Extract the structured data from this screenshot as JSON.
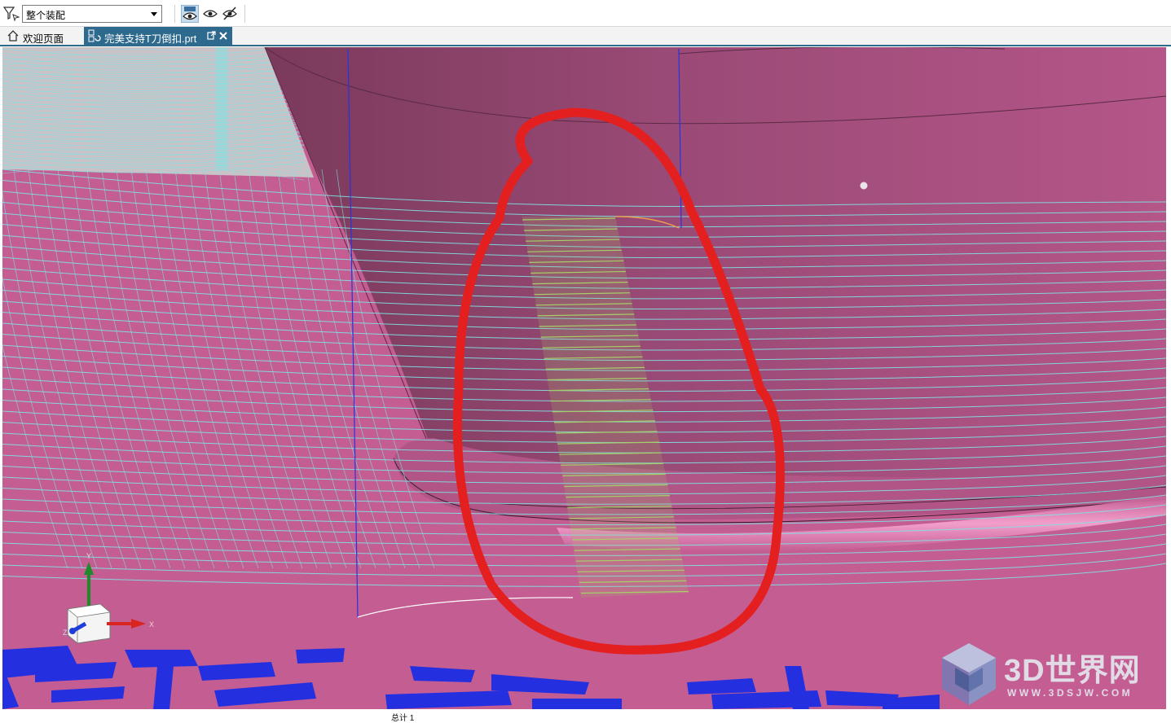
{
  "toolbar": {
    "selection_filter_value": "整个装配"
  },
  "tabs": [
    {
      "label": "欢迎页面",
      "active": false
    },
    {
      "label": "完美支持T刀倒扣.prt",
      "active": true
    }
  ],
  "viewport": {
    "background_color": "#c45d92",
    "toolpath_color": "#7fe3e6",
    "highlight_color": "#a6cf6a",
    "markup_color": "#e3201f",
    "triad_axes": {
      "x": "X",
      "y": "Y",
      "z": "Z"
    }
  },
  "watermark": {
    "brand": "3D世界网",
    "url": "WWW.3DSJW.COM"
  },
  "status": {
    "note": "总计 1"
  }
}
